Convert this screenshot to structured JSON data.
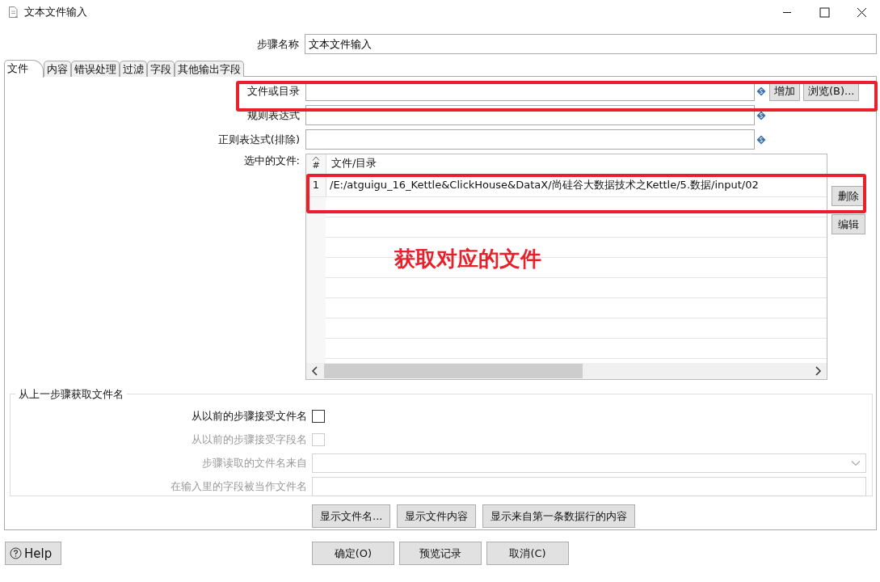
{
  "window": {
    "title": "文本文件输入"
  },
  "step_name": {
    "label": "步骤名称",
    "value": "文本文件输入"
  },
  "tabs": [
    {
      "label": "文件",
      "selected": true
    },
    {
      "label": "内容",
      "selected": false
    },
    {
      "label": "错误处理",
      "selected": false
    },
    {
      "label": "过滤",
      "selected": false
    },
    {
      "label": "字段",
      "selected": false
    },
    {
      "label": "其他输出字段",
      "selected": false
    }
  ],
  "file_fields": [
    {
      "label": "文件或目录",
      "buttons": [
        "增加",
        "浏览(B)..."
      ]
    },
    {
      "label": "规则表达式"
    },
    {
      "label": "正则表达式(排除)"
    }
  ],
  "selected_files": {
    "label": "选中的文件:",
    "columns": [
      "#",
      "文件/目录"
    ],
    "rows": [
      {
        "index": "1",
        "path": "/E:/atguigu_16_Kettle&ClickHouse&DataX/尚硅谷大数据技术之Kettle/5.数据/input/02"
      }
    ],
    "buttons": [
      "删除",
      "编辑"
    ]
  },
  "from_previous": {
    "title": "从上一步骤获取文件名",
    "rows": [
      {
        "kind": "checkbox",
        "label": "从以前的步骤接受文件名",
        "checked": false,
        "disabled": false
      },
      {
        "kind": "checkbox",
        "label": "从以前的步骤接受字段名",
        "checked": false,
        "disabled": true
      },
      {
        "kind": "dropdown",
        "label": "步骤读取的文件名来自",
        "disabled": true
      },
      {
        "kind": "text",
        "label": "在输入里的字段被当作文件名",
        "disabled": true
      }
    ]
  },
  "panel_buttons": [
    "显示文件名...",
    "显示文件内容",
    "显示来自第一条数据行的内容"
  ],
  "help_button": "Help",
  "dialog_buttons": [
    "确定(O)",
    "预览记录",
    "取消(C)"
  ],
  "annotation": {
    "text": "获取对应的文件"
  }
}
